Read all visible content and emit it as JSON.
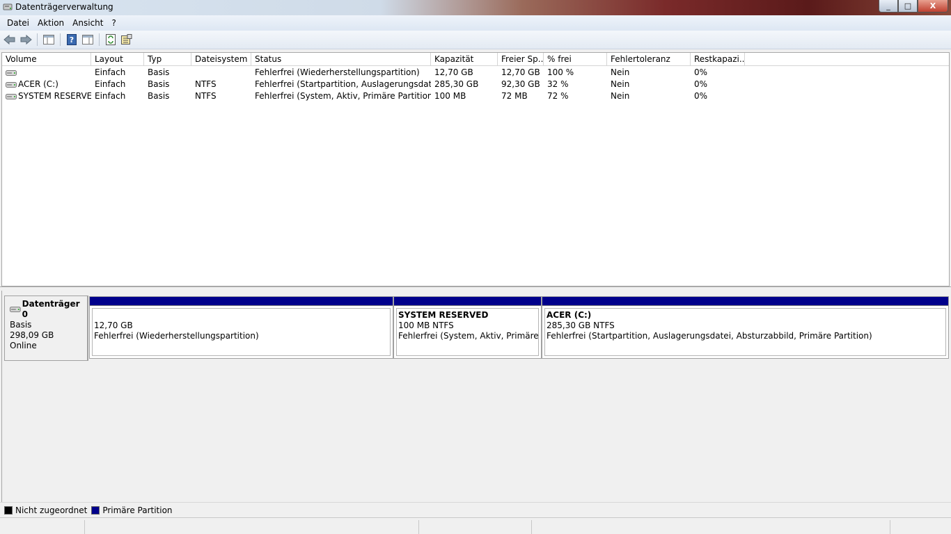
{
  "window": {
    "title": "Datenträgerverwaltung",
    "buttons": [
      "_",
      "□",
      "X"
    ]
  },
  "menu": [
    "Datei",
    "Aktion",
    "Ansicht",
    "?"
  ],
  "toolbar": [
    "back-icon",
    "forward-icon",
    "show-hide-tree-icon",
    "help-icon",
    "properties-view-icon",
    "refresh-icon",
    "properties-icon"
  ],
  "columns": [
    "Volume",
    "Layout",
    "Typ",
    "Dateisystem",
    "Status",
    "Kapazität",
    "Freier Sp...",
    "% frei",
    "Fehlertoleranz",
    "Restkapazi..."
  ],
  "volumes": [
    [
      "",
      "Einfach",
      "Basis",
      "",
      "Fehlerfrei (Wiederherstellungspartition)",
      "12,70 GB",
      "12,70 GB",
      "100 %",
      "Nein",
      "0%"
    ],
    [
      "ACER (C:)",
      "Einfach",
      "Basis",
      "NTFS",
      "Fehlerfrei (Startpartition, Auslagerungsdatei, ...",
      "285,30 GB",
      "92,30 GB",
      "32 %",
      "Nein",
      "0%"
    ],
    [
      "SYSTEM RESERVED",
      "Einfach",
      "Basis",
      "NTFS",
      "Fehlerfrei (System, Aktiv, Primäre Partition)",
      "100 MB",
      "72 MB",
      "72 %",
      "Nein",
      "0%"
    ]
  ],
  "disk": {
    "name": "Datenträger 0",
    "type": "Basis",
    "size": "298,09 GB",
    "state": "Online",
    "partitions": [
      {
        "name": "",
        "size": "12,70 GB",
        "status": "Fehlerfrei (Wiederherstellungspartition)"
      },
      {
        "name": "SYSTEM RESERVED",
        "size": "100 MB NTFS",
        "status": "Fehlerfrei (System, Aktiv, Primäre Part"
      },
      {
        "name": "ACER  (C:)",
        "size": "285,30 GB NTFS",
        "status": "Fehlerfrei (Startpartition, Auslagerungsdatei, Absturzabbild, Primäre Partition)"
      }
    ]
  },
  "legend": [
    {
      "label": "Nicht zugeordnet",
      "color": "#000000"
    },
    {
      "label": "Primäre Partition",
      "color": "#00008b"
    }
  ]
}
